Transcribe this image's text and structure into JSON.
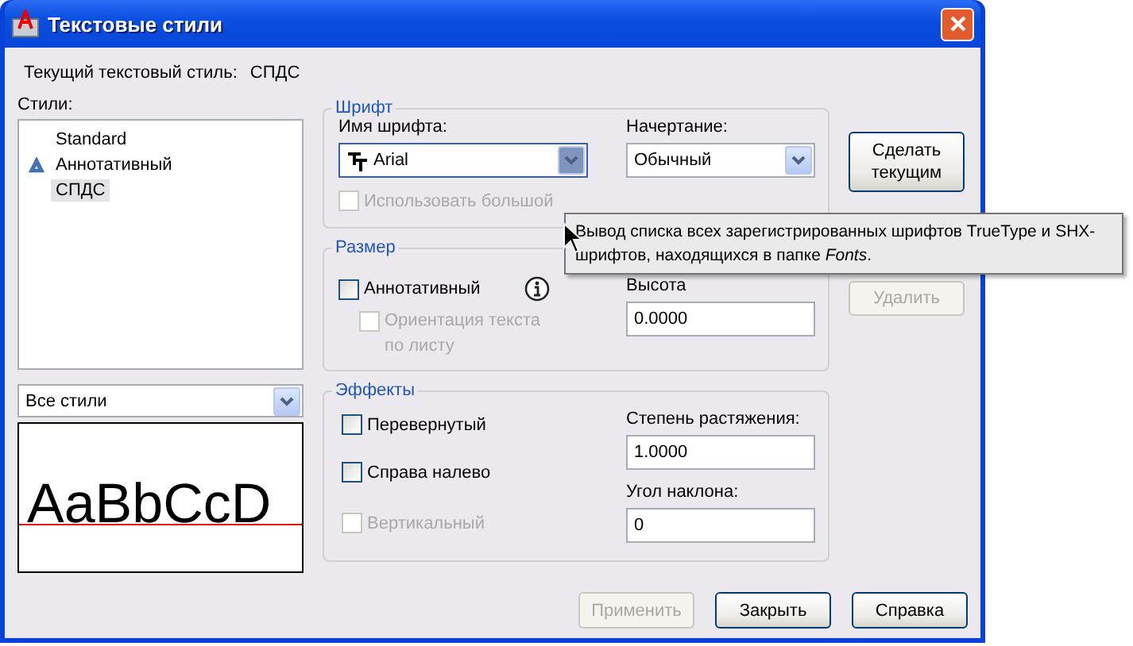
{
  "window": {
    "title": "Текстовые стили"
  },
  "current_style": {
    "label": "Текущий текстовый стиль:",
    "value": "СПДС"
  },
  "styles": {
    "label": "Стили:",
    "items": [
      {
        "name": "Standard",
        "annotative": false,
        "selected": false
      },
      {
        "name": "Аннотативный",
        "annotative": true,
        "selected": false
      },
      {
        "name": "СПДС",
        "annotative": false,
        "selected": true
      }
    ]
  },
  "filter": {
    "value": "Все стили"
  },
  "preview": {
    "text": "AaBbCcD"
  },
  "font": {
    "title": "Шрифт",
    "name_label": "Имя шрифта:",
    "name_value": "Arial",
    "style_label": "Начертание:",
    "style_value": "Обычный",
    "big_font": {
      "label": "Использовать большой",
      "checked": false,
      "disabled": true
    }
  },
  "size": {
    "title": "Размер",
    "annotative": {
      "label": "Аннотативный",
      "checked": false,
      "disabled": false
    },
    "orientation": {
      "label": "Ориентация текста по листу",
      "checked": false,
      "disabled": true
    },
    "height_label": "Высота",
    "height_value": "0.0000"
  },
  "effects": {
    "title": "Эффекты",
    "checkboxes": [
      {
        "label": "Перевернутый",
        "checked": false,
        "disabled": false
      },
      {
        "label": "Справа налево",
        "checked": false,
        "disabled": false
      },
      {
        "label": "Вертикальный",
        "checked": false,
        "disabled": true
      }
    ],
    "width_label": "Степень растяжения:",
    "width_value": "1.0000",
    "oblique_label": "Угол наклона:",
    "oblique_value": "0"
  },
  "side_buttons": [
    {
      "label": "Сделать текущим",
      "disabled": false
    },
    {
      "label": "Удалить",
      "disabled": true
    }
  ],
  "bottom_buttons": [
    {
      "label": "Применить",
      "disabled": true
    },
    {
      "label": "Закрыть",
      "disabled": false
    },
    {
      "label": "Справка",
      "disabled": false
    }
  ],
  "tooltip": {
    "text": "Вывод списка всех зарегистрированных шрифтов TrueType и SHX-шрифтов, находящихся в папке *Fonts*."
  }
}
